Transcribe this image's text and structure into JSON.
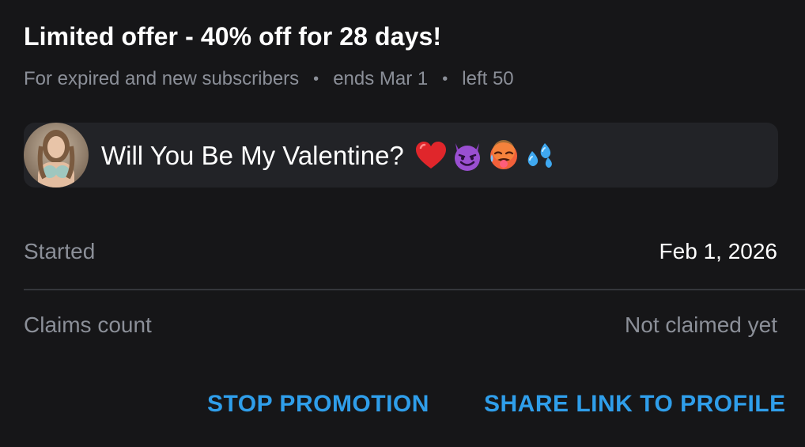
{
  "offer": {
    "title": "Limited offer - 40% off for 28 days!",
    "audience": "For expired and new subscribers",
    "ends": "ends Mar 1",
    "left": "left 50",
    "separator": "•"
  },
  "message": {
    "text": "Will You Be My Valentine?",
    "emojis": [
      "red-heart-emoji",
      "smiling-devil-emoji",
      "hot-face-emoji",
      "sweat-droplets-emoji"
    ]
  },
  "details": {
    "started_label": "Started",
    "started_value": "Feb 1, 2026",
    "claims_label": "Claims count",
    "claims_value": "Not claimed yet"
  },
  "actions": {
    "stop_label": "STOP PROMOTION",
    "share_label": "SHARE LINK TO PROFILE"
  },
  "colors": {
    "background": "#161618",
    "card": "#222327",
    "muted_text": "#8b8f98",
    "accent": "#2f9eea"
  }
}
